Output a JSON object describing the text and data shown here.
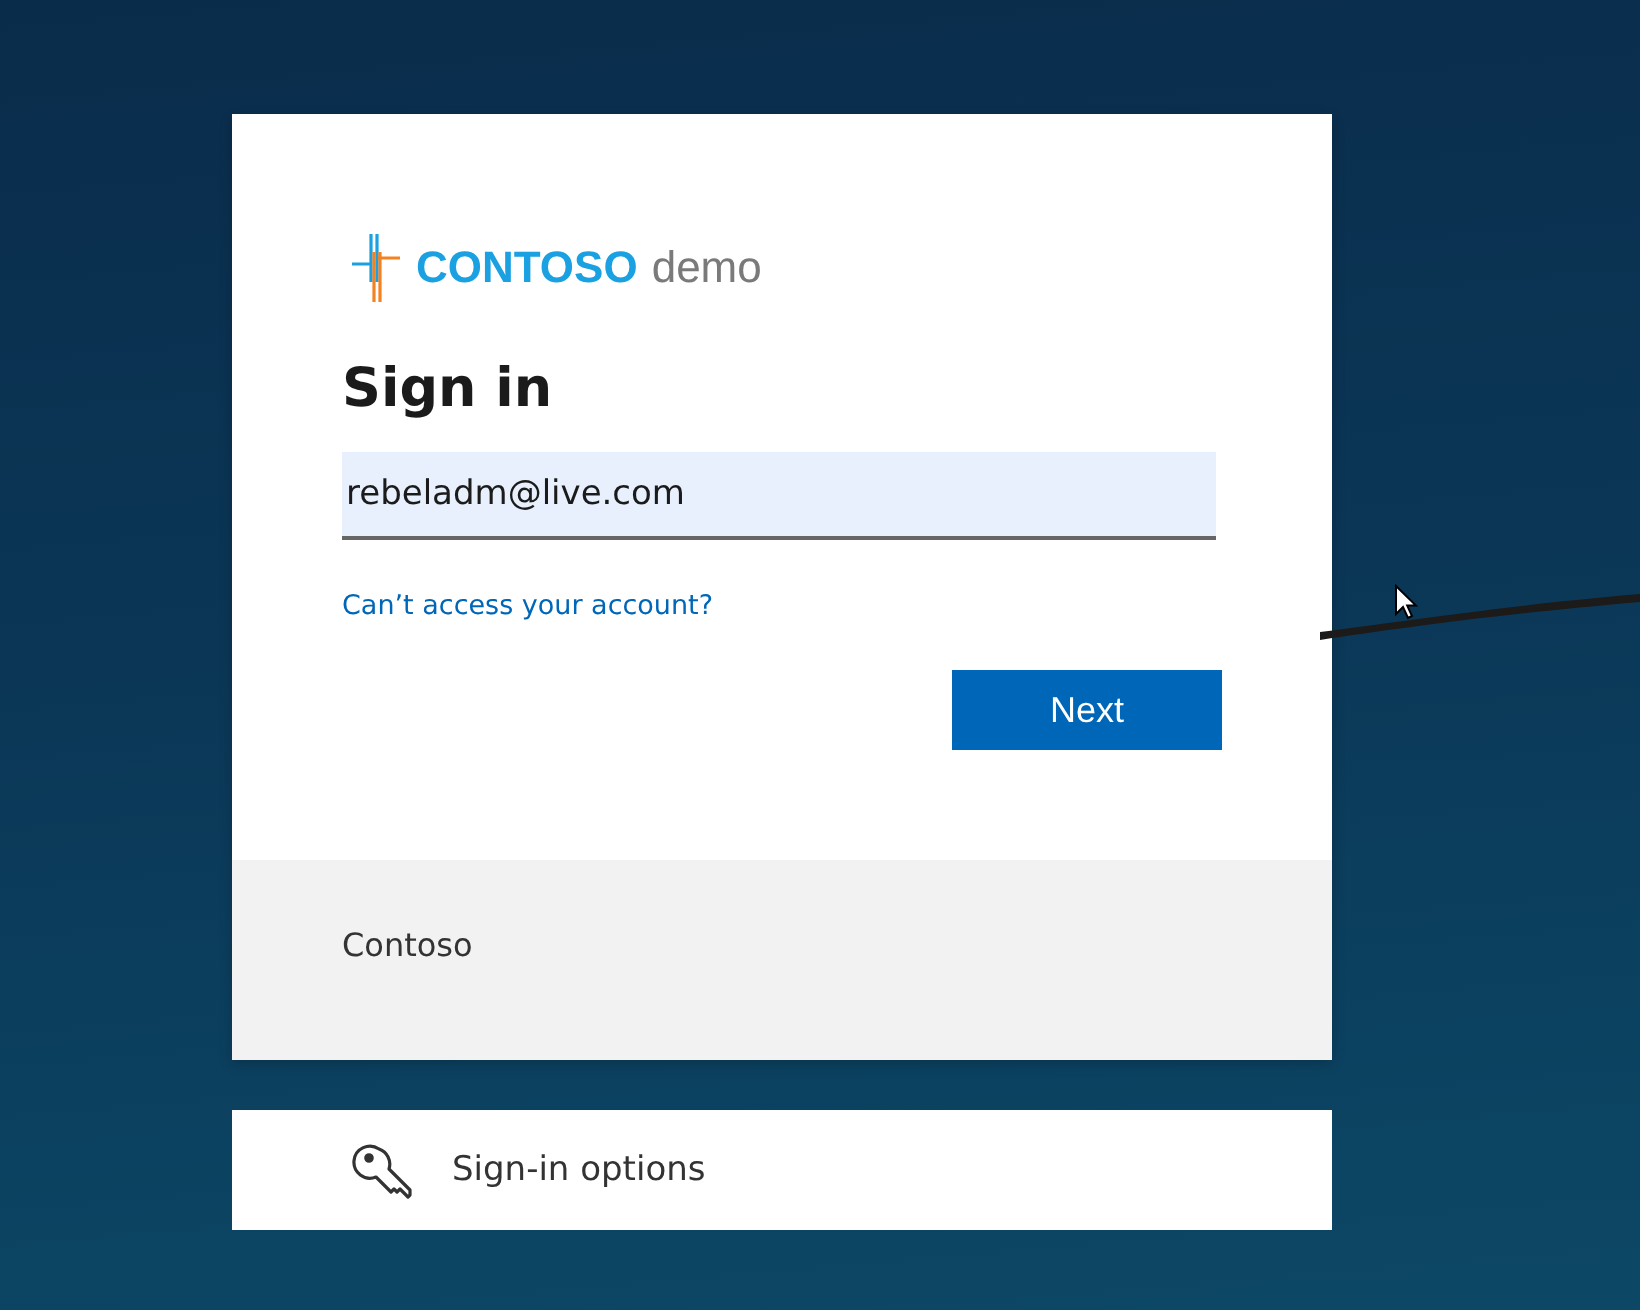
{
  "logo": {
    "brand": "CONTOSO",
    "suffix": "demo"
  },
  "sign_in": {
    "title": "Sign in",
    "email_field": {
      "value": "rebeladm@live.com"
    },
    "help_link": "Can’t access your account?",
    "next_button": "Next"
  },
  "footer": {
    "text": "Contoso"
  },
  "sign_in_options": {
    "label": "Sign-in options"
  }
}
